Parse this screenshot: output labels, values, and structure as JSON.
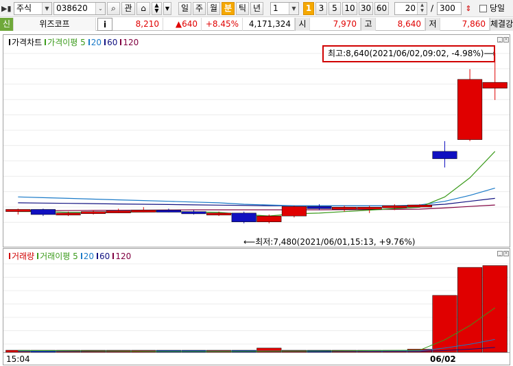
{
  "toolbar": {
    "market_type": "주식",
    "stock_code": "038620",
    "btn_search": "⌕",
    "btn_interest": "관",
    "periods": [
      "일",
      "주",
      "월",
      "분",
      "틱",
      "년"
    ],
    "selected_period": "분",
    "interval_value": "1",
    "interval_badge": "1",
    "quick_intervals": [
      "3",
      "5",
      "10",
      "30",
      "60"
    ],
    "count_value": "20",
    "count_sep": "/",
    "count_total": "300",
    "same_day_label": "당일"
  },
  "info": {
    "market_badge": "신",
    "name": "위즈코프",
    "info_btn": "i",
    "price": "8,210",
    "change": "▲640",
    "change_pct": "+8.45%",
    "volume": "4,171,324",
    "open_label": "시",
    "open": "7,970",
    "high_label": "고",
    "high": "8,640",
    "low_label": "저",
    "low": "7,860",
    "trade_label": "체결강"
  },
  "price_panel": {
    "legend": [
      {
        "text": "가격차트",
        "color": "#000000"
      },
      {
        "text": "가격이평 5",
        "color": "#3a9a1a"
      },
      {
        "text": "20",
        "color": "#1a7ac8"
      },
      {
        "text": "60",
        "color": "#101080"
      },
      {
        "text": "120",
        "color": "#800040"
      }
    ],
    "high_annotation": "최고:8,640(2021/06/02,09:02, -4.98%)⟶",
    "low_annotation": "⟵최저:7,480(2021/06/01,15:13, +9.76%)"
  },
  "volume_panel": {
    "legend": [
      {
        "text": "거래량",
        "color": "#d00000"
      },
      {
        "text": "거래이평 5",
        "color": "#3a9a1a"
      },
      {
        "text": "20",
        "color": "#1a7ac8"
      },
      {
        "text": "60",
        "color": "#101080"
      },
      {
        "text": "120",
        "color": "#800040"
      }
    ]
  },
  "x_axis": {
    "left_label": "15:04",
    "date_label": "06/02"
  },
  "colors": {
    "up": "#e00000",
    "down": "#1010c0",
    "ma5": "#3a9a1a",
    "ma20": "#1a7ac8",
    "ma60": "#101080",
    "ma120": "#800040",
    "annotation_border": "#d00000"
  },
  "chart_data": {
    "type": "candlestick",
    "x_start": "15:04",
    "date_change_at": "06/02",
    "candles": [
      {
        "o": 7560,
        "h": 7580,
        "l": 7540,
        "c": 7575,
        "up": true
      },
      {
        "o": 7575,
        "h": 7580,
        "l": 7530,
        "c": 7540,
        "up": false
      },
      {
        "o": 7545,
        "h": 7560,
        "l": 7530,
        "c": 7550,
        "up": true
      },
      {
        "o": 7550,
        "h": 7570,
        "l": 7540,
        "c": 7560,
        "up": true
      },
      {
        "o": 7560,
        "h": 7580,
        "l": 7550,
        "c": 7565,
        "up": true
      },
      {
        "o": 7565,
        "h": 7590,
        "l": 7555,
        "c": 7570,
        "up": true
      },
      {
        "o": 7570,
        "h": 7580,
        "l": 7555,
        "c": 7560,
        "up": false
      },
      {
        "o": 7560,
        "h": 7570,
        "l": 7540,
        "c": 7545,
        "up": false
      },
      {
        "o": 7545,
        "h": 7560,
        "l": 7530,
        "c": 7550,
        "up": true
      },
      {
        "o": 7550,
        "h": 7560,
        "l": 7480,
        "c": 7490,
        "up": false
      },
      {
        "o": 7490,
        "h": 7540,
        "l": 7480,
        "c": 7530,
        "up": true
      },
      {
        "o": 7530,
        "h": 7600,
        "l": 7520,
        "c": 7595,
        "up": true
      },
      {
        "o": 7595,
        "h": 7610,
        "l": 7570,
        "c": 7580,
        "up": false
      },
      {
        "o": 7580,
        "h": 7600,
        "l": 7560,
        "c": 7590,
        "up": true
      },
      {
        "o": 7590,
        "h": 7600,
        "l": 7550,
        "c": 7585,
        "up": true
      },
      {
        "o": 7585,
        "h": 7610,
        "l": 7570,
        "c": 7600,
        "up": true
      },
      {
        "o": 7600,
        "h": 7610,
        "l": 7590,
        "c": 7605,
        "up": true
      },
      {
        "o": 7970,
        "h": 8040,
        "l": 7860,
        "c": 7920,
        "up": false
      },
      {
        "o": 8050,
        "h": 8530,
        "l": 8040,
        "c": 8460,
        "up": true
      },
      {
        "o": 8400,
        "h": 8640,
        "l": 8320,
        "c": 8440,
        "up": true
      }
    ],
    "volumes": [
      18000,
      15000,
      12000,
      12000,
      13000,
      13000,
      14000,
      15000,
      16000,
      45000,
      95000,
      35000,
      40000,
      40000,
      32000,
      42000,
      70000,
      1280000,
      1910000,
      1950000
    ],
    "volume_up": [
      true,
      false,
      true,
      true,
      true,
      true,
      false,
      false,
      true,
      false,
      true,
      true,
      false,
      true,
      true,
      true,
      true,
      true,
      true,
      true
    ],
    "ma5": [
      7560,
      7560,
      7555,
      7555,
      7556,
      7558,
      7560,
      7558,
      7555,
      7540,
      7530,
      7545,
      7550,
      7560,
      7570,
      7580,
      7590,
      7660,
      7790,
      7970
    ],
    "ma20": [
      7660,
      7655,
      7650,
      7645,
      7640,
      7635,
      7630,
      7625,
      7620,
      7610,
      7605,
      7600,
      7600,
      7600,
      7600,
      7600,
      7605,
      7630,
      7670,
      7720
    ],
    "ma60": [
      7620,
      7618,
      7616,
      7614,
      7612,
      7610,
      7608,
      7606,
      7604,
      7602,
      7600,
      7600,
      7600,
      7600,
      7600,
      7600,
      7600,
      7610,
      7630,
      7650
    ],
    "ma120": [
      7565,
      7566,
      7567,
      7568,
      7569,
      7570,
      7571,
      7572,
      7572,
      7572,
      7572,
      7572,
      7572,
      7573,
      7574,
      7575,
      7577,
      7585,
      7595,
      7605
    ],
    "vol_ma5": [
      40000,
      38000,
      35000,
      30000,
      26000,
      22000,
      20000,
      18000,
      19000,
      22000,
      25000,
      28000,
      30000,
      34000,
      38000,
      42000,
      48000,
      280000,
      600000,
      1000000
    ],
    "vol_ma20": [
      30000,
      30000,
      29000,
      29000,
      28000,
      28000,
      27000,
      27000,
      27000,
      28000,
      29000,
      30000,
      30000,
      31000,
      31000,
      32000,
      33000,
      95000,
      180000,
      290000
    ],
    "vol_ma60": [
      22000,
      22000,
      22000,
      22000,
      22000,
      22000,
      22000,
      22000,
      22000,
      22000,
      22000,
      22000,
      22000,
      22000,
      22000,
      22000,
      22000,
      40000,
      70000,
      110000
    ],
    "price_ylim": [
      7400,
      8660
    ],
    "volume_ylim": [
      0,
      2050000
    ]
  }
}
